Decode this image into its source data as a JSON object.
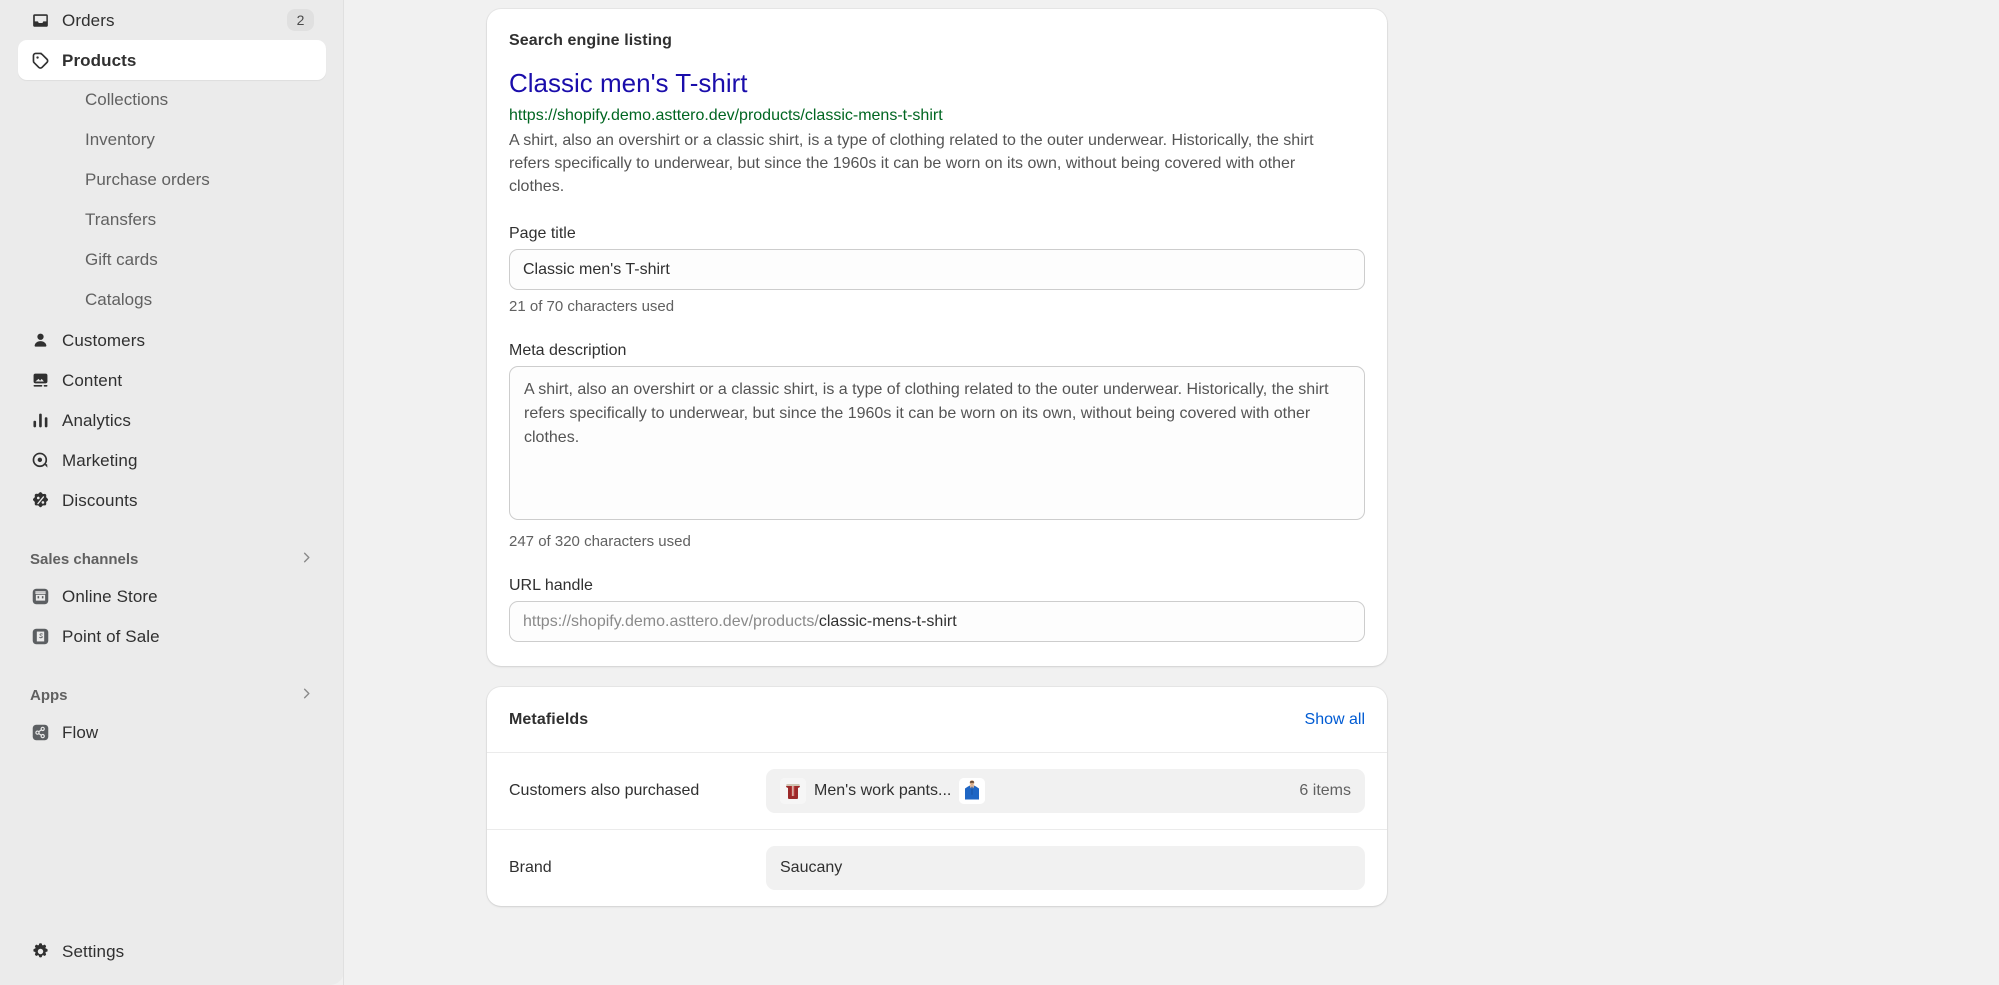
{
  "sidebar": {
    "items": [
      {
        "label": "Orders",
        "icon": "orders-icon",
        "badge": "2",
        "selected": false
      },
      {
        "label": "Products",
        "icon": "tag-icon",
        "badge": "",
        "selected": true
      }
    ],
    "product_subitems": [
      {
        "label": "Collections"
      },
      {
        "label": "Inventory"
      },
      {
        "label": "Purchase orders"
      },
      {
        "label": "Transfers"
      },
      {
        "label": "Gift cards"
      },
      {
        "label": "Catalogs"
      }
    ],
    "items2": [
      {
        "label": "Customers",
        "icon": "person-icon"
      },
      {
        "label": "Content",
        "icon": "content-icon"
      },
      {
        "label": "Analytics",
        "icon": "analytics-icon"
      },
      {
        "label": "Marketing",
        "icon": "marketing-icon"
      },
      {
        "label": "Discounts",
        "icon": "discount-icon"
      }
    ],
    "sales_channels": {
      "heading": "Sales channels",
      "items": [
        {
          "label": "Online Store",
          "icon": "online-store-icon"
        },
        {
          "label": "Point of Sale",
          "icon": "point-of-sale-icon"
        }
      ]
    },
    "apps": {
      "heading": "Apps",
      "items": [
        {
          "label": "Flow",
          "icon": "flow-icon"
        }
      ]
    },
    "settings": {
      "label": "Settings",
      "icon": "gear-icon"
    }
  },
  "seo_card": {
    "title": "Search engine listing",
    "preview": {
      "title": "Classic men's T-shirt",
      "url": "https://shopify.demo.asttero.dev/products/classic-mens-t-shirt",
      "description": "A shirt, also an overshirt or a classic shirt, is a type of clothing related to the outer underwear. Historically, the shirt refers specifically to underwear, but since the 1960s it can be worn on its own, without being covered with other clothes."
    },
    "page_title": {
      "label": "Page title",
      "value": "Classic men's T-shirt",
      "placeholder": "Classic men's T-shirt",
      "helper": "21 of 70 characters used"
    },
    "meta_description": {
      "label": "Meta description",
      "value": "A shirt, also an overshirt or a classic shirt, is a type of clothing related to the outer underwear. Historically, the shirt refers specifically to underwear, but since the 1960s it can be worn on its own, without being covered with other clothes.",
      "placeholder": "Meta description",
      "helper": "247 of 320 characters used"
    },
    "url_handle": {
      "label": "URL handle",
      "prefix": "https://shopify.demo.asttero.dev/products/",
      "handle": "classic-mens-t-shirt"
    }
  },
  "metafields": {
    "title": "Metafields",
    "show_all": "Show all",
    "rows": [
      {
        "key": "Customers also purchased",
        "value": "Men's work pants...",
        "count": "6 items",
        "thumbs": [
          "red-pants-thumb",
          "blue-hoodie-thumb"
        ]
      },
      {
        "key": "Brand",
        "value": "Saucany",
        "count": "",
        "thumbs": []
      }
    ]
  },
  "colors": {
    "sidebar_bg": "#ebebeb",
    "page_bg": "#f1f1f1",
    "card_bg": "#ffffff",
    "link_blue": "#005bd3",
    "preview_title_blue": "#1a0dab",
    "preview_url_green": "#006621",
    "text_primary": "#303030",
    "text_secondary": "#616161"
  }
}
